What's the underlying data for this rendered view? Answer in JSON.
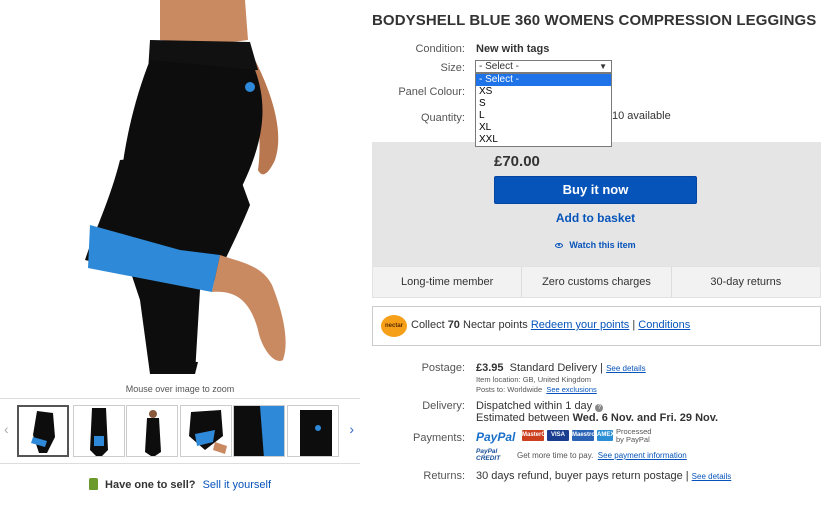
{
  "gallery": {
    "zoom_hint": "Mouse over image to zoom",
    "thumbnails": [
      "thumb-1",
      "thumb-2",
      "thumb-3",
      "thumb-4",
      "thumb-5",
      "thumb-6"
    ],
    "left_arrow": "‹",
    "right_arrow": "›"
  },
  "sell": {
    "prompt": "Have one to sell?",
    "link": "Sell it yourself"
  },
  "product": {
    "title": "BODYSHELL BLUE 360 WOMENS COMPRESSION LEGGINGS",
    "condition_label": "Condition:",
    "condition_value": "New with tags",
    "size_label": "Size:",
    "size_selected": "- Select -",
    "size_caret": "▼",
    "size_options": [
      "- Select -",
      "XS",
      "S",
      "L",
      "XL",
      "XXL"
    ],
    "panel_colour_label": "Panel Colour:",
    "quantity_label": "Quantity:",
    "available": "10 available"
  },
  "buy": {
    "price": "£70.00",
    "buy_now": "Buy it now",
    "add_to_basket": "Add to basket",
    "watch": "Watch this item"
  },
  "badges": [
    "Long-time member",
    "Zero customs charges",
    "30-day returns"
  ],
  "nectar": {
    "logo": "nectar",
    "collect_prefix": "Collect ",
    "points": "70",
    "collect_suffix": " Nectar points ",
    "redeem_link": "Redeem your points",
    "separator": " | ",
    "conditions_link": "Conditions"
  },
  "postage": {
    "label": "Postage:",
    "price": "£3.95",
    "service": "Standard Delivery",
    "separator": "|",
    "details_link": "See details",
    "item_location": "Item location:  GB, United Kingdom",
    "posts_to_prefix": "Posts to:  Worldwide",
    "exclusions_link": "See exclusions"
  },
  "delivery": {
    "label": "Delivery:",
    "dispatch": "Dispatched within 1 day",
    "estimated_prefix": "Estimated between ",
    "estimated_dates": "Wed. 6 Nov. and Fri. 29 Nov."
  },
  "payments": {
    "label": "Payments:",
    "paypal": "PayPal",
    "cards": [
      "MasterCard",
      "VISA",
      "Maestro",
      "AMEX"
    ],
    "processed": "Processed",
    "by_paypal": "by PayPal",
    "credit_text": "Get more time to pay.",
    "credit_link": "See payment information",
    "credit_logo_top": "PayPal",
    "credit_logo_bottom": "CREDIT"
  },
  "returns": {
    "label": "Returns:",
    "text": "30 days refund, buyer pays return postage |",
    "link": "See details"
  },
  "colors": {
    "accent": "#0654ba",
    "legging_black": "#0d0d0d",
    "legging_blue": "#2e8ad8",
    "skin": "#c98a62"
  }
}
